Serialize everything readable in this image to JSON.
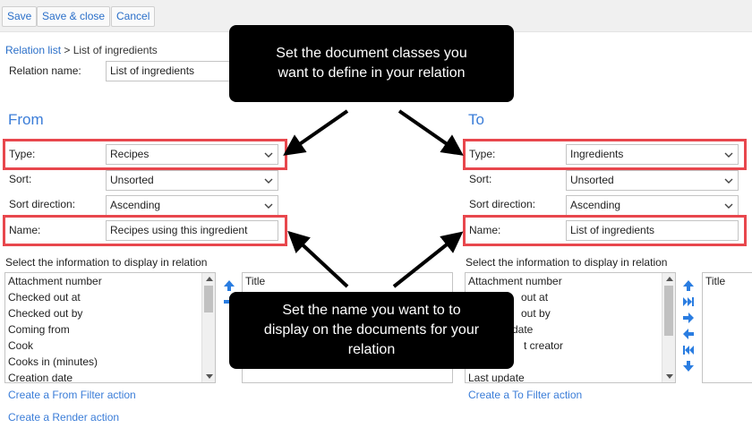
{
  "toolbar": {
    "save": "Save",
    "save_close": "Save & close",
    "cancel": "Cancel"
  },
  "breadcrumb": {
    "parent": "Relation list",
    "separator": " > ",
    "current": "List of ingredients"
  },
  "relation_name": {
    "label": "Relation name:",
    "value": "List of ingredients"
  },
  "from": {
    "title": "From",
    "type_label": "Type:",
    "type_value": "Recipes",
    "sort_label": "Sort:",
    "sort_value": "Unsorted",
    "direction_label": "Sort direction:",
    "direction_value": "Ascending",
    "name_label": "Name:",
    "name_value": "Recipes using this ingredient",
    "select_info_label": "Select the information to display in relation",
    "available": [
      "Attachment number",
      "Checked out at",
      "Checked out by",
      "Coming from",
      "Cook",
      "Cooks in (minutes)",
      "Creation date"
    ],
    "selected": [
      "Title"
    ],
    "filter_link": "Create a From Filter action",
    "render_link": "Create a Render action"
  },
  "to": {
    "title": "To",
    "type_label": "Type:",
    "type_value": "Ingredients",
    "sort_label": "Sort:",
    "sort_value": "Unsorted",
    "direction_label": "Sort direction:",
    "direction_value": "Ascending",
    "name_label": "Name:",
    "name_value": "List of ingredients",
    "select_info_label": "Select the information to display in relation",
    "available": [
      "Attachment number",
      "Checked out at",
      "Checked out by",
      "Creation date",
      "Document creator",
      "",
      "Last update"
    ],
    "available_partial": [
      "Attachment number",
      "out at",
      "out by",
      "date",
      "t creator",
      "",
      "Last update"
    ],
    "selected": [
      "Title"
    ],
    "filter_link": "Create a To Filter action"
  },
  "callouts": {
    "top": [
      "Set the document classes you",
      "want to define in your relation"
    ],
    "bottom": [
      "Set the name you want to to",
      "display on the documents for your",
      "relation"
    ]
  },
  "colors": {
    "accent": "#3b7dd8",
    "highlight": "#e8474d",
    "callout_bg": "#000000",
    "arrow_blue": "#2a7de1"
  }
}
